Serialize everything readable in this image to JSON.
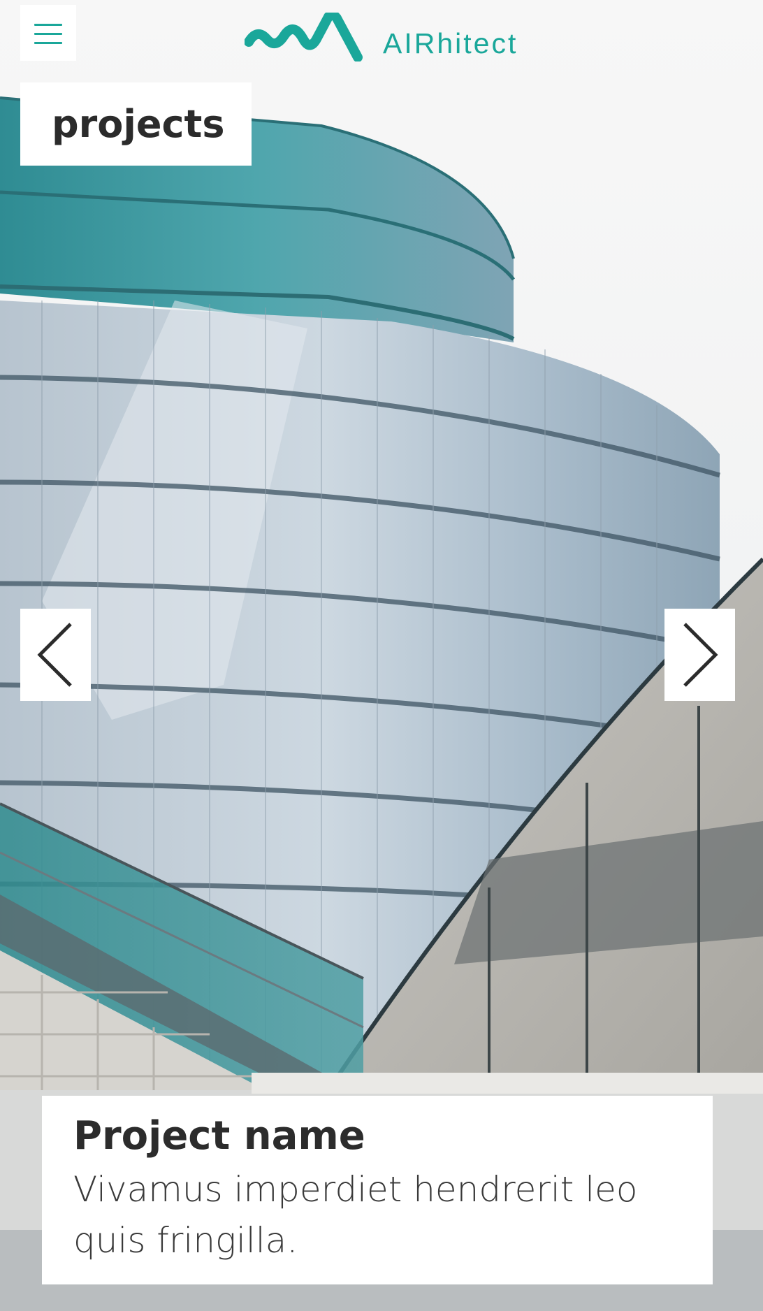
{
  "brand": {
    "name": "AIRhitect",
    "accent_color": "#1aa79a"
  },
  "header": {
    "menu_icon": "hamburger-menu-icon",
    "logo_icon": "wave-logo-icon"
  },
  "page": {
    "label": "projects"
  },
  "carousel": {
    "prev_icon": "chevron-left-icon",
    "next_icon": "chevron-right-icon",
    "slide_image": "photo of curved tiled building with staircase"
  },
  "project": {
    "name": "Project name",
    "description": "Vivamus imperdiet hendrerit leo quis fringilla."
  }
}
